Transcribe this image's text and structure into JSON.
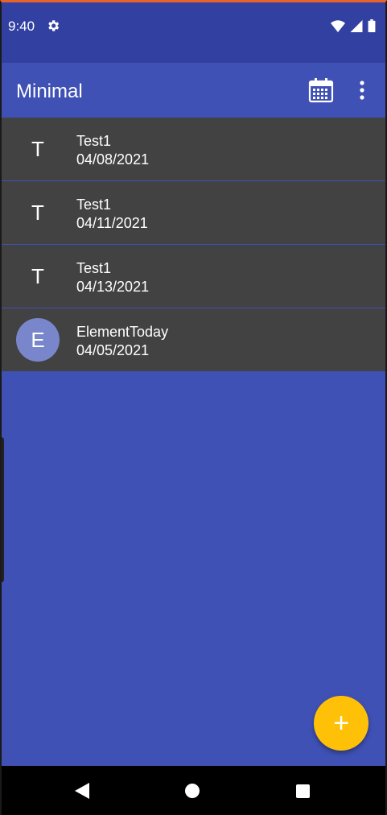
{
  "status_bar": {
    "time": "9:40"
  },
  "app_bar": {
    "title": "Minimal"
  },
  "items": [
    {
      "avatar": "T",
      "title": "Test1",
      "date": "04/08/2021"
    },
    {
      "avatar": "T",
      "title": "Test1",
      "date": "04/11/2021"
    },
    {
      "avatar": "T",
      "title": "Test1",
      "date": "04/13/2021"
    },
    {
      "avatar": "E",
      "title": "ElementToday",
      "date": "04/05/2021"
    }
  ],
  "fab": {
    "label": "+"
  },
  "colors": {
    "primary": "#3f51b5",
    "primary_dark": "#3240a2",
    "list_bg": "#424242",
    "accent": "#ffc107",
    "avatar_fill": "#7986cb"
  },
  "icons": {
    "status": [
      "settings-gear-icon",
      "wifi-icon",
      "cell-signal-icon",
      "battery-icon"
    ],
    "app_bar": [
      "calendar-icon",
      "more-vert-icon"
    ],
    "nav": [
      "back-icon",
      "home-icon",
      "recents-icon"
    ]
  }
}
